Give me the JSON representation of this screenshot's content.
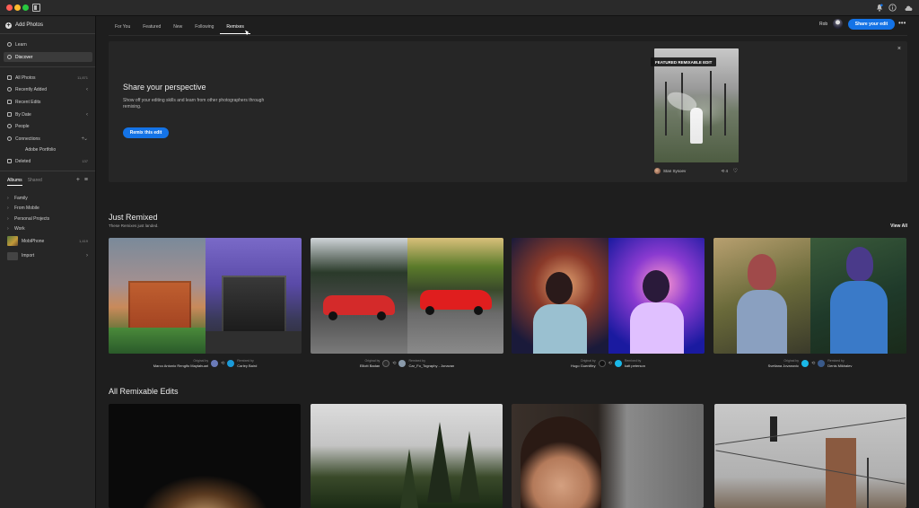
{
  "sidebar": {
    "add_photos": "Add Photos",
    "learn": "Learn",
    "discover": "Discover",
    "all_photos": "All Photos",
    "all_photos_count": "11,871",
    "recently_added": "Recently Added",
    "recent_edits": "Recent Edits",
    "by_date": "By Date",
    "people": "People",
    "connections": "Connections",
    "adobe_portfolio": "Adobe Portfolio",
    "deleted": "Deleted",
    "deleted_count": "137",
    "tab_albums": "Albums",
    "tab_shared": "Shared",
    "albums": [
      "Family",
      "From Mobile",
      "Personal Projects",
      "Work"
    ],
    "mobiphone": "MobiPhone",
    "mobiphone_count": "1,419",
    "import": "Import"
  },
  "tabs": [
    "For You",
    "Featured",
    "New",
    "Following",
    "Remixes"
  ],
  "header": {
    "user_name": "Rob",
    "share_label": "Share your edit",
    "more_label": "•••"
  },
  "banner": {
    "title": "Share your perspective",
    "description": "Show off your editing skills and learn from other photographers through remixing.",
    "button": "Remix this edit",
    "featured_label": "FEATURED REMIXABLE EDIT",
    "author": "Stan Sysoev",
    "remix_count": "4",
    "close": "×"
  },
  "just_remixed": {
    "title": "Just Remixed",
    "subtitle": "These Remixes just landed.",
    "view_all": "View All",
    "original_by": "Original by",
    "remixed_by": "Remixed by",
    "cards": [
      {
        "original": "Marco Antonio Rengifo Maytahuari",
        "remixer": "Carley Baird"
      },
      {
        "original": "Elliott Badan",
        "remixer": "Car_Fo_Tography - Jonavan"
      },
      {
        "original": "Hugo Guenifley",
        "remixer": "katt peterson"
      },
      {
        "original": "Svetlana Jovanovic",
        "remixer": "Denis Mikhalev"
      }
    ]
  },
  "all_remixable": {
    "title": "All Remixable Edits"
  },
  "icons": {
    "bell": "bell-icon",
    "info": "info-icon",
    "cloud": "cloud-icon",
    "remix": "remix-icon",
    "heart": "heart-icon"
  },
  "colors": {
    "accent": "#1473e6",
    "background": "#1e1e1e",
    "sidebar": "#262626"
  }
}
